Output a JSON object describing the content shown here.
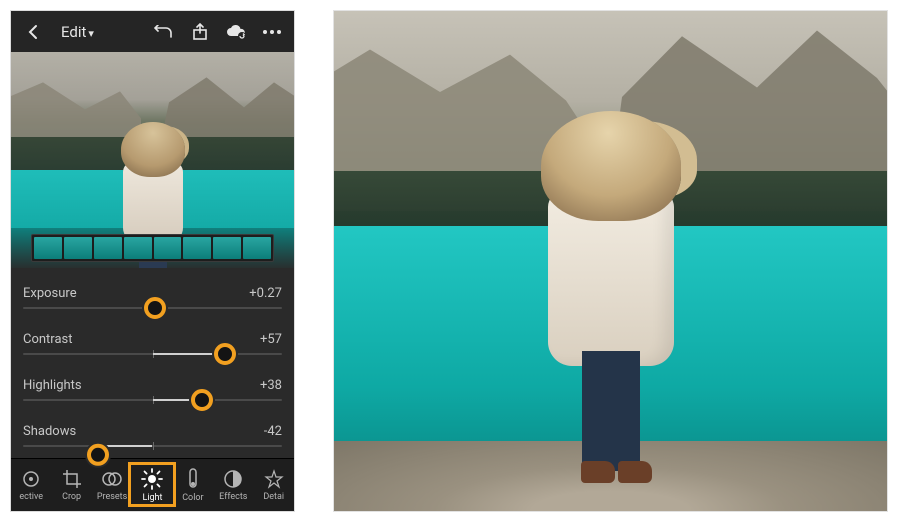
{
  "app": {
    "title": "Edit"
  },
  "sliders": [
    {
      "label": "Exposure",
      "value_text": "+0.27",
      "pct": 51,
      "fill_from": 50,
      "fill_to": 51
    },
    {
      "label": "Contrast",
      "value_text": "+57",
      "pct": 78,
      "fill_from": 50,
      "fill_to": 78
    },
    {
      "label": "Highlights",
      "value_text": "+38",
      "pct": 69,
      "fill_from": 50,
      "fill_to": 69
    },
    {
      "label": "Shadows",
      "value_text": "-42",
      "pct": 29,
      "fill_from": 29,
      "fill_to": 50
    }
  ],
  "toolbar": [
    {
      "id": "selective",
      "label": "ective"
    },
    {
      "id": "crop",
      "label": "Crop"
    },
    {
      "id": "presets",
      "label": "Presets"
    },
    {
      "id": "light",
      "label": "Light",
      "active": true
    },
    {
      "id": "color",
      "label": "Color"
    },
    {
      "id": "effects",
      "label": "Effects"
    },
    {
      "id": "detail",
      "label": "Detai"
    }
  ],
  "highlight_color": "#f2a020"
}
